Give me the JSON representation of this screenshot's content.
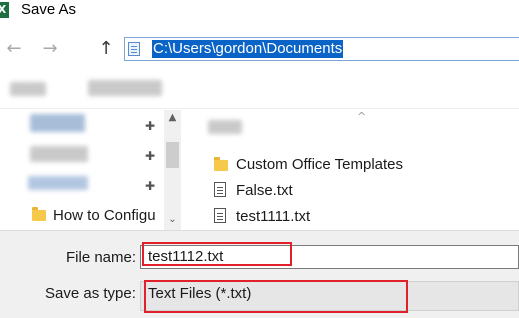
{
  "window": {
    "title": "Save As",
    "app_icon": "excel-icon",
    "app_icon_glyph": "X"
  },
  "nav": {
    "back_icon": "←",
    "forward_icon": "→",
    "up_icon": "↑",
    "address": "C:\\Users\\gordon\\Documents"
  },
  "nav_pane": {
    "pinned_icon": "✚",
    "items": [
      {
        "label": "How to Configu"
      }
    ],
    "scroll_up": "▲",
    "scroll_down": "⌄"
  },
  "file_list": {
    "sort_indicator": "^",
    "items": [
      {
        "label": "Custom Office Templates",
        "icon": "folder-icon"
      },
      {
        "label": "False.txt",
        "icon": "text-file-icon"
      },
      {
        "label": "test1111.txt",
        "icon": "text-file-icon"
      }
    ]
  },
  "save": {
    "file_name_label": "File name:",
    "file_name_value": "test1112.txt",
    "save_as_type_label": "Save as type:",
    "save_as_type_value": "Text Files (*.txt)"
  },
  "colors": {
    "highlight_box": "#e0202a",
    "selection": "#0a64c8"
  }
}
